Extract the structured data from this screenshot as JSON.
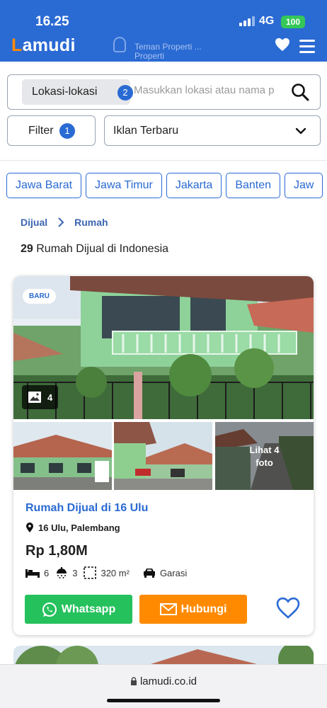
{
  "status_bar": {
    "time": "16.25",
    "network": "4G",
    "battery": "100"
  },
  "header": {
    "logo": "Lamudi",
    "tagline_line1": "Teman Properti ...",
    "tagline_line2": "Properti"
  },
  "search": {
    "location_chip": "Lokasi-lokasi",
    "location_count": "2",
    "placeholder": "Masukkan lokasi atau nama p"
  },
  "filter": {
    "label": "Filter",
    "count": "1"
  },
  "sort": {
    "selected": "Iklan Terbaru"
  },
  "region_chips": [
    "Jawa Barat",
    "Jawa Timur",
    "Jakarta",
    "Banten",
    "Jaw"
  ],
  "breadcrumb": {
    "level1": "Dijual",
    "level2": "Rumah"
  },
  "results": {
    "count": "29",
    "text": "Rumah Dijual di Indonesia"
  },
  "listing": {
    "badge": "BARU",
    "photo_count": "4",
    "more_photos_line1": "Lihat 4",
    "more_photos_line2": "foto",
    "title": "Rumah Dijual di 16 Ulu",
    "location": "16 Ulu, Palembang",
    "price": "Rp 1,80M",
    "bedrooms": "6",
    "bathrooms": "3",
    "area": "320 m²",
    "garage": "Garasi",
    "whatsapp_label": "Whatsapp",
    "contact_label": "Hubungi"
  },
  "browser": {
    "url": "lamudi.co.id"
  },
  "colors": {
    "brand_blue": "#2a6ad3",
    "whatsapp_green": "#25c15d",
    "contact_orange": "#ff8a00"
  }
}
